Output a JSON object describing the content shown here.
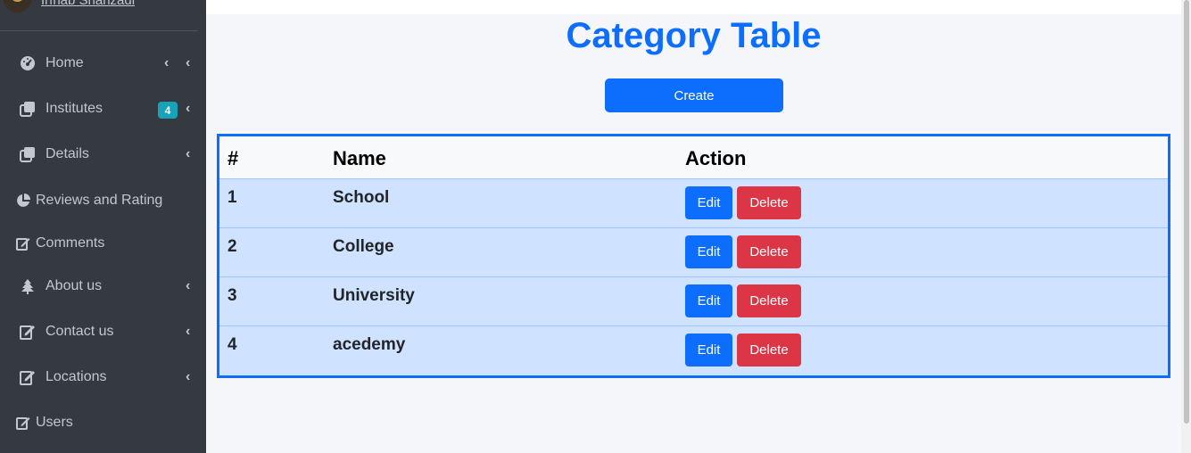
{
  "user": {
    "name": "Irfhab Shahzadi"
  },
  "sidebar": {
    "items": [
      {
        "label": "Home",
        "icon": "dashboard-icon"
      },
      {
        "label": "Institutes",
        "icon": "copy-icon",
        "badge": "4"
      },
      {
        "label": "Details",
        "icon": "copy-icon"
      },
      {
        "label": "Reviews and Rating",
        "icon": "pie-chart-icon"
      },
      {
        "label": "Comments",
        "icon": "edit-icon"
      },
      {
        "label": "About us",
        "icon": "tree-icon"
      },
      {
        "label": "Contact us",
        "icon": "edit-icon"
      },
      {
        "label": "Locations",
        "icon": "edit-icon"
      },
      {
        "label": "Users",
        "icon": "edit-icon"
      }
    ],
    "chevron": "‹"
  },
  "main": {
    "title": "Category Table",
    "create_label": "Create",
    "table": {
      "headers": [
        "#",
        "Name",
        "Action"
      ],
      "rows": [
        {
          "id": "1",
          "name": "School"
        },
        {
          "id": "2",
          "name": "College"
        },
        {
          "id": "3",
          "name": "University"
        },
        {
          "id": "4",
          "name": "acedemy"
        }
      ],
      "edit_label": "Edit",
      "delete_label": "Delete"
    }
  },
  "colors": {
    "primary": "#0d6efd",
    "danger": "#dc3545",
    "sidebar_bg": "#343a40",
    "row_bg": "#cfe2ff",
    "badge": "#17a2b8"
  }
}
